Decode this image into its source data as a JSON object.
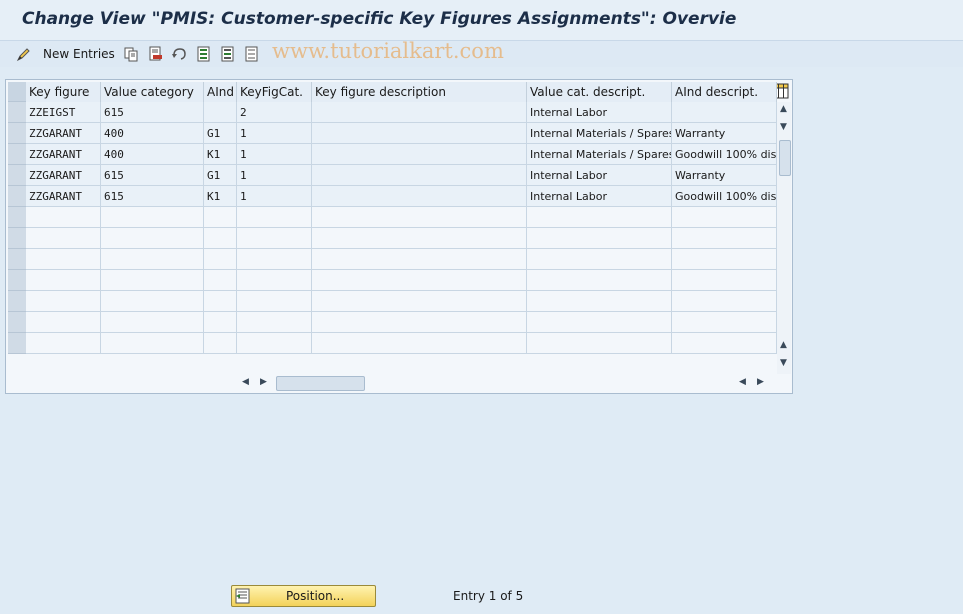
{
  "title": "Change View \"PMIS: Customer-specific Key Figures Assignments\": Overvie",
  "toolbar": {
    "new_entries": "New Entries"
  },
  "watermark": "www.tutorialkart.com",
  "table": {
    "columns": [
      "Key figure",
      "Value category",
      "AInd",
      "KeyFigCat.",
      "Key figure description",
      "Value cat. descript.",
      "AInd descript."
    ],
    "rows": [
      [
        "ZZEIGST",
        "615",
        "",
        "2",
        "",
        "Internal Labor",
        ""
      ],
      [
        "ZZGARANT",
        "400",
        "G1",
        "1",
        "",
        "Internal Materials / Spares",
        "Warranty"
      ],
      [
        "ZZGARANT",
        "400",
        "K1",
        "1",
        "",
        "Internal Materials / Spares",
        "Goodwill 100% dis"
      ],
      [
        "ZZGARANT",
        "615",
        "G1",
        "1",
        "",
        "Internal Labor",
        "Warranty"
      ],
      [
        "ZZGARANT",
        "615",
        "K1",
        "1",
        "",
        "Internal Labor",
        "Goodwill 100% dis"
      ]
    ]
  },
  "footer": {
    "position_button": "Position...",
    "entry_info": "Entry 1 of 5"
  }
}
